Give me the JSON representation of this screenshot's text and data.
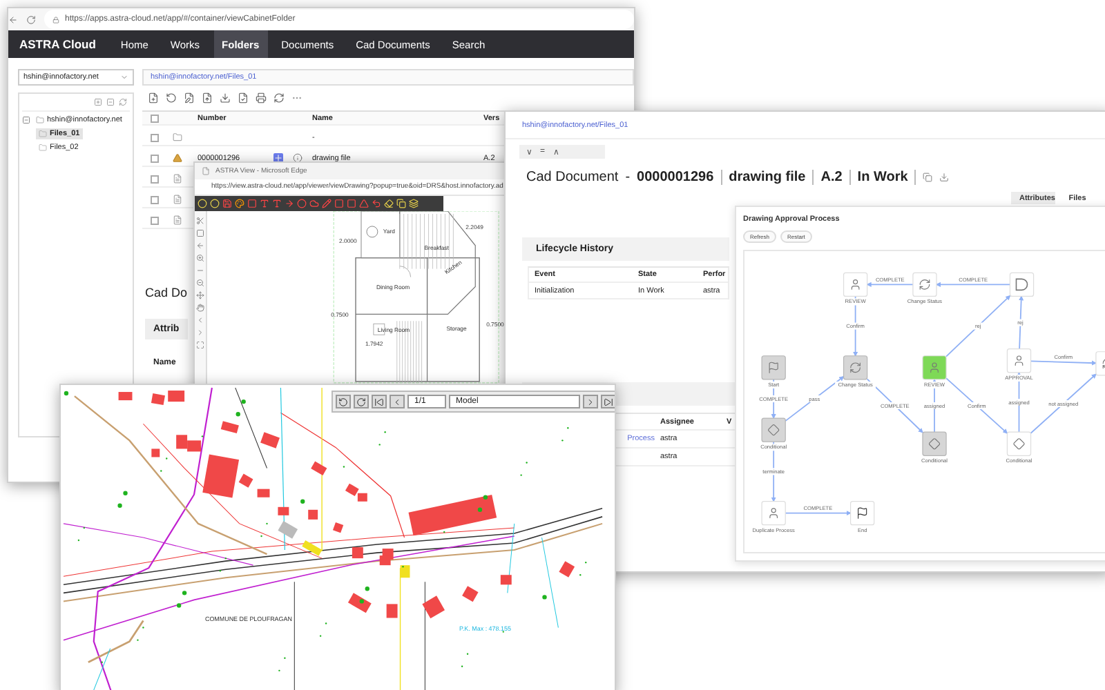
{
  "browser": {
    "url": "https://apps.astra-cloud.net/app/#/container/viewCabinetFolder",
    "brand": "ASTRA Cloud",
    "nav": [
      {
        "label": "Home",
        "selected": false
      },
      {
        "label": "Works",
        "selected": false
      },
      {
        "label": "Folders",
        "selected": true
      },
      {
        "label": "Documents",
        "selected": false
      },
      {
        "label": "Cad Documents",
        "selected": false
      },
      {
        "label": "Search",
        "selected": false
      }
    ],
    "account_select": "hshin@innofactory.net",
    "tree": {
      "label": "hshin@innofactory.net",
      "expanded": true,
      "children": [
        {
          "label": "Files_01",
          "selected": true
        },
        {
          "label": "Files_02",
          "selected": false
        }
      ]
    },
    "breadcrumb": "hshin@innofactory.net/Files_01",
    "table": {
      "all_checked": false,
      "columns": [
        "Number",
        "Name",
        "Vers"
      ],
      "rows": [
        {
          "kind": "folder",
          "checked": false,
          "name": "-"
        },
        {
          "kind": "cad",
          "checked": false,
          "number": "0000001296",
          "name": "drawing file",
          "version": "A.2"
        },
        {
          "kind": "doc",
          "checked": false
        },
        {
          "kind": "doc",
          "checked": false
        },
        {
          "kind": "doc",
          "checked": false
        }
      ]
    },
    "detail": {
      "title": "Cad Do",
      "tab": "Attrib",
      "field": "Name"
    }
  },
  "viewer_popup": {
    "title": "ASTRA View - Microsoft Edge",
    "url": "https://view.astra-cloud.net/app/viewer/viewDrawing?popup=true&oid=DRS&host.innofactory.ad",
    "plan_labels": [
      "Yard",
      "Breakfast",
      "Kitchen",
      "Dining Room",
      "Living Room",
      "Storage",
      "2.0000",
      "2.2049",
      "0.7500",
      "0.7500",
      "1.7942"
    ]
  },
  "document": {
    "breadcrumb": "hshin@innofactory.net/Files_01",
    "toolbar": [
      "∨",
      "=",
      "∧"
    ],
    "kind": "Cad Document",
    "separator": "-",
    "parts": [
      "0000001296",
      "drawing file",
      "A.2",
      "In Work"
    ],
    "tabs": [
      {
        "label": "Attributes",
        "selected": true
      },
      {
        "label": "Files",
        "selected": false
      }
    ],
    "lifecycle": {
      "title": "Lifecycle History",
      "columns": [
        "Event",
        "State",
        "Perfor"
      ],
      "rows": [
        [
          "Initialization",
          "In Work",
          "astra"
        ]
      ]
    },
    "tasks": {
      "columns": [
        "Assignee",
        "V"
      ],
      "rows": [
        {
          "process": "Process",
          "assignee": "astra"
        },
        {
          "assignee": "astra"
        }
      ]
    },
    "workflow": {
      "title": "Drawing Approval Process",
      "buttons": [
        "Refresh",
        "Restart"
      ],
      "nodes": [
        {
          "label": "REVIEW",
          "kind": "user",
          "done": false,
          "active": false
        },
        {
          "label": "Change Status",
          "kind": "status",
          "done": false,
          "active": false
        },
        {
          "kind": "exit",
          "done": false,
          "active": false
        },
        {
          "label": "Start",
          "kind": "start",
          "done": true,
          "active": false
        },
        {
          "label": "Change Status",
          "kind": "status",
          "done": true,
          "active": false
        },
        {
          "label": "REVIEW",
          "kind": "user",
          "done": false,
          "active": true
        },
        {
          "label": "APPROVAL",
          "kind": "user",
          "done": false,
          "active": false
        },
        {
          "kind": "status",
          "done": false,
          "active": false
        },
        {
          "label": "Conditional",
          "kind": "gateway",
          "done": true,
          "active": false
        },
        {
          "label": "Conditional",
          "kind": "gateway",
          "done": true,
          "active": false
        },
        {
          "label": "Conditional",
          "kind": "gateway",
          "done": false,
          "active": false
        },
        {
          "label": "Duplicate Process",
          "kind": "user",
          "done": false,
          "active": false
        },
        {
          "label": "End",
          "kind": "end",
          "done": false,
          "active": false
        }
      ],
      "edges": [
        {
          "label": "COMPLETE"
        },
        {
          "label": "COMPLETE"
        },
        {
          "label": "Confirm"
        },
        {
          "label": "COMPLETE"
        },
        {
          "label": "pass"
        },
        {
          "label": "COMPLETE"
        },
        {
          "label": "assigned"
        },
        {
          "label": "rej"
        },
        {
          "label": "Confirm"
        },
        {
          "label": "assigned"
        },
        {
          "label": "rej"
        },
        {
          "label": "Confirm"
        },
        {
          "label": "not assigned"
        },
        {
          "label": "terminate"
        },
        {
          "label": "COMPLETE"
        }
      ]
    }
  },
  "cad_viewer": {
    "page": "1/1",
    "layout": "Model",
    "labels": [
      "COMMUNE DE PLOUFRAGAN",
      "P.K. Max : 478.155"
    ]
  }
}
